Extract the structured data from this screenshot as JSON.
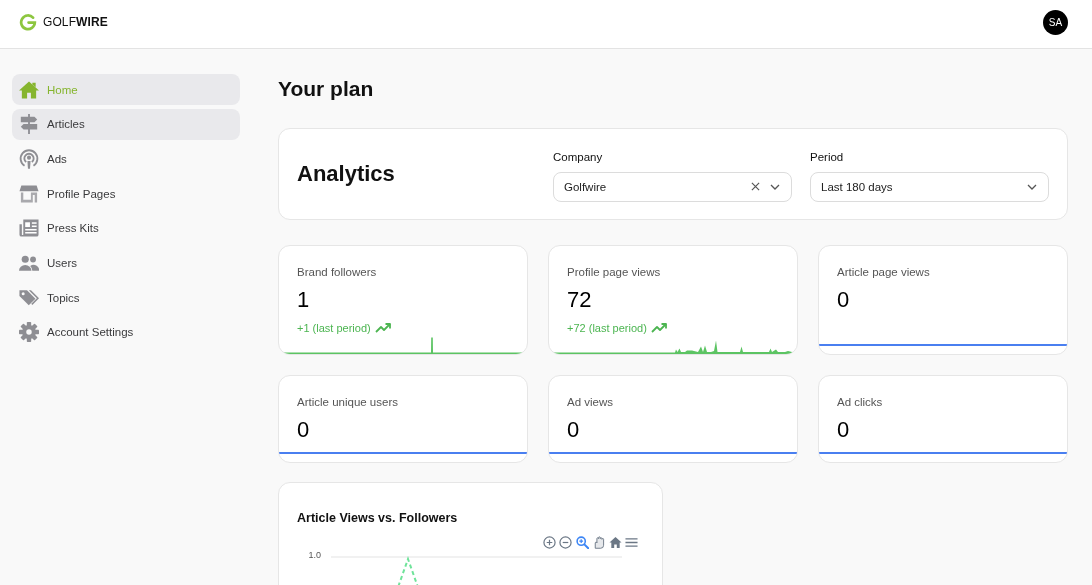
{
  "header": {
    "logo": "GOLF**WIRE**",
    "avatar": "SA"
  },
  "sidebar": {
    "items": [
      {
        "label": "Home",
        "selected": true,
        "hovered": false
      },
      {
        "label": "Articles",
        "selected": false,
        "hovered": true
      },
      {
        "label": "Ads",
        "selected": false,
        "hovered": false
      },
      {
        "label": "Profile Pages",
        "selected": false,
        "hovered": false
      },
      {
        "label": "Press Kits",
        "selected": false,
        "hovered": false
      },
      {
        "label": "Users",
        "selected": false,
        "hovered": false
      },
      {
        "label": "Topics",
        "selected": false,
        "hovered": false
      },
      {
        "label": "Account Settings",
        "selected": false,
        "hovered": false
      }
    ]
  },
  "page_title": "Your plan",
  "analytics": {
    "title": "Analytics",
    "filters": [
      {
        "label": "Company",
        "value": "Golfwire",
        "clearable": true
      },
      {
        "label": "Period",
        "value": "Last 180 days",
        "clearable": false
      }
    ]
  },
  "stats": [
    {
      "label": "Brand followers",
      "value": "1",
      "trend": "+1 (last period)",
      "kind": "spike"
    },
    {
      "label": "Profile page views",
      "value": "72",
      "trend": "+72 (last period)",
      "kind": "bursts"
    },
    {
      "label": "Article page views",
      "value": "0",
      "kind": "flat"
    },
    {
      "label": "Article unique users",
      "value": "0",
      "kind": "flat"
    },
    {
      "label": "Ad views",
      "value": "0",
      "kind": "flat"
    },
    {
      "label": "Ad clicks",
      "value": "0",
      "kind": "flat"
    }
  ],
  "chart": {
    "title": "Article Views vs. Followers",
    "toolbar": [
      {
        "kind": "zoom-in",
        "selected": false
      },
      {
        "kind": "zoom-out",
        "selected": false
      },
      {
        "kind": "selection-zoom",
        "selected": true
      },
      {
        "kind": "pan",
        "selected": false
      },
      {
        "kind": "reset",
        "selected": false
      },
      {
        "kind": "menu",
        "selected": false
      }
    ],
    "y_ticks": [
      "1.0"
    ]
  }
}
